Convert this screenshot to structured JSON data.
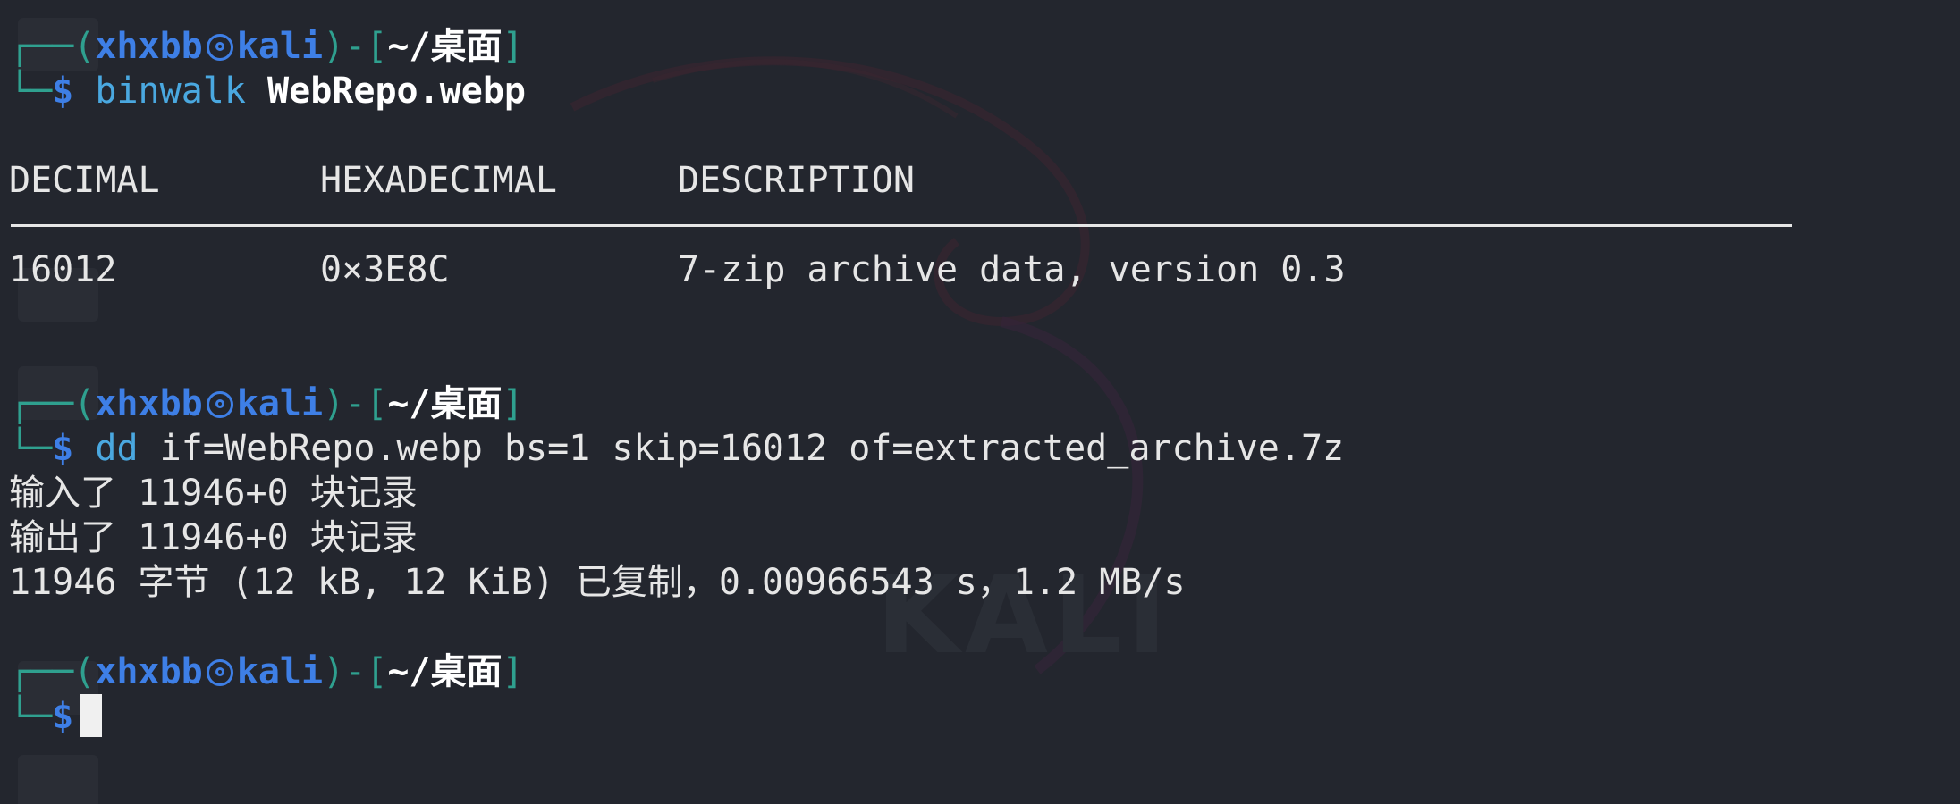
{
  "prompt": {
    "open_frame": "┌──(",
    "user": "xhxbb",
    "host": "kali",
    "close_frame": ")-[",
    "path": "~/桌面",
    "end_bracket": "]",
    "cmd_frame": "└─",
    "dollar": "$"
  },
  "commands": {
    "cmd1_name": "binwalk",
    "cmd1_arg": "WebRepo.webp",
    "cmd2_name": "dd",
    "cmd2_args": "if=WebRepo.webp bs=1 skip=16012 of=extracted_archive.7z"
  },
  "binwalk_table": {
    "headers": [
      "DECIMAL",
      "HEXADECIMAL",
      "DESCRIPTION"
    ],
    "rows": [
      [
        "16012",
        "0×3E8C",
        "7-zip archive data, version 0.3"
      ]
    ]
  },
  "dd_output": [
    "输入了 11946+0 块记录",
    "输出了 11946+0 块记录",
    "11946 字节 (12 kB, 12 KiB) 已复制，0.00966543 s，1.2 MB/s"
  ],
  "watermark": "KALI",
  "colors": {
    "background": "#23262e",
    "frame": "#2fa08f",
    "user_host": "#3e7fe6",
    "command": "#4aa8e0",
    "text": "#e6e6e6"
  }
}
